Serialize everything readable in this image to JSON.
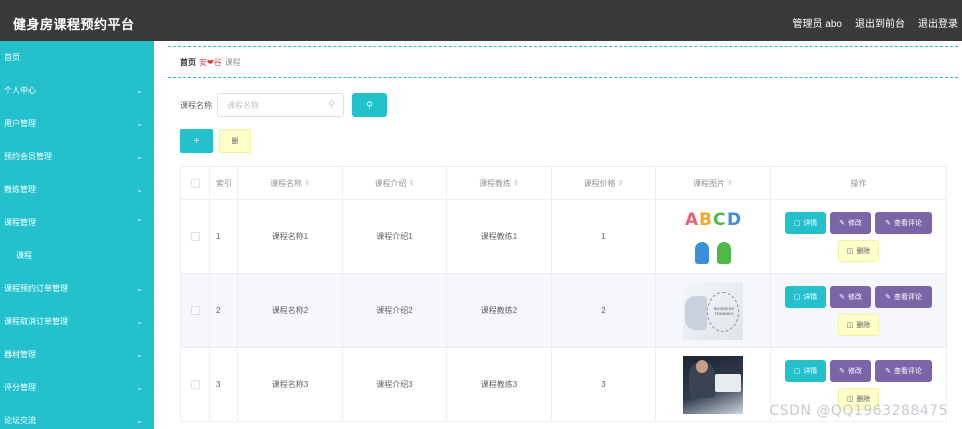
{
  "header": {
    "title": "健身房课程预约平台",
    "admin_label": "管理员 abo",
    "front_link": "退出到前台",
    "logout_link": "退出登录"
  },
  "sidebar": {
    "items": [
      {
        "label": "首页",
        "chevron": ""
      },
      {
        "label": "个人中心",
        "chevron": "⌄"
      },
      {
        "label": "用户管理",
        "chevron": "⌄"
      },
      {
        "label": "预约会员管理",
        "chevron": "⌄"
      },
      {
        "label": "教练管理",
        "chevron": "⌄"
      },
      {
        "label": "课程管理",
        "chevron": "⌃"
      },
      {
        "label": "课程",
        "chevron": ""
      },
      {
        "label": "课程预约订单管理",
        "chevron": "⌄"
      },
      {
        "label": "课程取消订单管理",
        "chevron": "⌄"
      },
      {
        "label": "器材管理",
        "chevron": "⌄"
      },
      {
        "label": "评分管理",
        "chevron": "⌄"
      },
      {
        "label": "论坛交流",
        "chevron": "⌄"
      }
    ]
  },
  "breadcrumb": {
    "home": "首页",
    "separator": "安❤谷",
    "current": "课程"
  },
  "search": {
    "label": "课程名称",
    "placeholder": "课程名称",
    "icon": "search-icon",
    "button_icon": "search-icon"
  },
  "actions": {
    "add_label": "+",
    "delete_label": "删"
  },
  "table": {
    "headers": {
      "index": "索引",
      "name": "课程名称",
      "intro": "课程介绍",
      "coach": "课程教练",
      "price": "课程价格",
      "image": "课程图片",
      "ops": "操作"
    },
    "sort_glyph": "⇕",
    "rows": [
      {
        "index": "1",
        "name": "课程名称1",
        "intro": "课程介绍1",
        "coach": "课程教练1",
        "price": "1"
      },
      {
        "index": "2",
        "name": "课程名称2",
        "intro": "课程介绍2",
        "coach": "课程教练2",
        "price": "2"
      },
      {
        "index": "3",
        "name": "课程名称3",
        "intro": "课程介绍3",
        "coach": "课程教练3",
        "price": "3"
      }
    ],
    "ops": {
      "detail": "详情",
      "edit": "修改",
      "review": "查看评论",
      "delete": "删除"
    },
    "image_texts": {
      "abc": [
        "A",
        "B",
        "C",
        "D"
      ],
      "business": "BUSINESS TRAINING"
    }
  },
  "watermark": "CSDN @QQ1963288475",
  "colors": {
    "accent": "#24c1cd",
    "header": "#3a3a3a",
    "purple": "#7b64a8",
    "yellow": "#ffffc8"
  }
}
